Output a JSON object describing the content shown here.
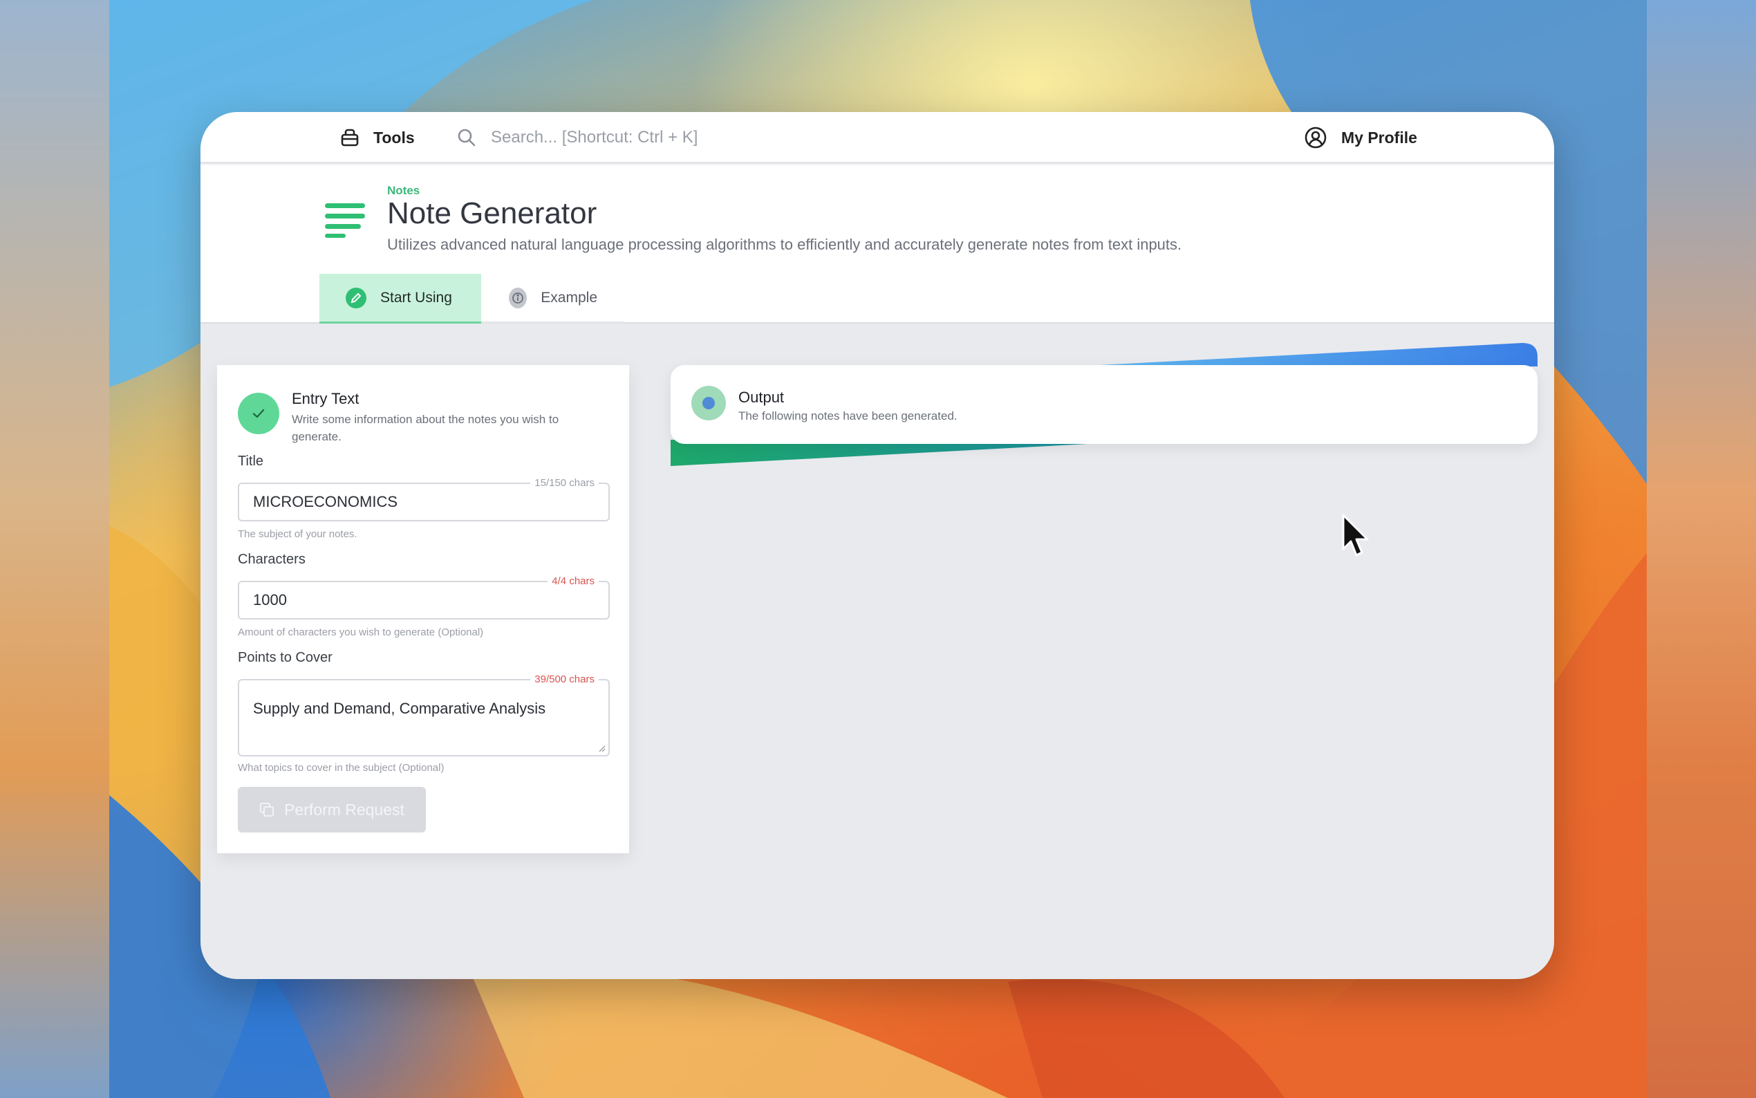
{
  "topbar": {
    "tools_label": "Tools",
    "search_placeholder": "Search... [Shortcut: Ctrl + K]",
    "profile_label": "My Profile"
  },
  "header": {
    "category": "Notes",
    "title": "Note Generator",
    "description": "Utilizes advanced natural language processing algorithms to efficiently and accurately generate notes from text inputs."
  },
  "tabs": [
    {
      "label": "Start Using",
      "icon": "pencil-icon",
      "active": true
    },
    {
      "label": "Example",
      "icon": "info-icon",
      "active": false
    }
  ],
  "entry": {
    "title": "Entry Text",
    "subtitle": "Write some information about the notes you wish to generate.",
    "fields": [
      {
        "label": "Title",
        "value": "MICROECONOMICS",
        "counter": "15/150 chars",
        "helper": "The subject of your notes."
      },
      {
        "label": "Characters",
        "value": "1000",
        "counter": "4/4 chars",
        "helper": "Amount of characters you wish to generate (Optional)"
      },
      {
        "label": "Points to Cover",
        "value": "Supply and Demand, Comparative Analysis",
        "counter": "39/500 chars",
        "helper": "What topics to cover in the subject (Optional)"
      }
    ],
    "button_label": "Perform Request"
  },
  "output": {
    "title": "Output",
    "subtitle": "The following notes have been generated."
  },
  "colors": {
    "accent_green": "#2fbf74",
    "tab_active_bg": "#c9f2dc",
    "counter_warning": "#d9534f",
    "stripe_blue": "#3b82e6"
  }
}
